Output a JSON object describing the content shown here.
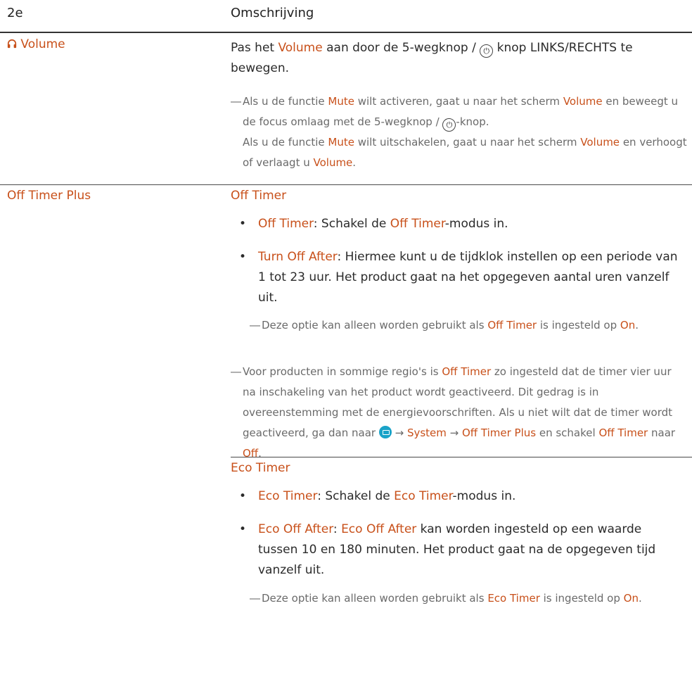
{
  "header": {
    "col1": "2e",
    "col2": "Omschrijving"
  },
  "volume": {
    "label": "Volume",
    "desc": [
      "Pas het ",
      "Volume",
      " aan door de 5-wegknop / ",
      " knop LINKS/RECHTS te bewegen."
    ],
    "note": [
      "Als u de functie ",
      "Mute",
      " wilt activeren, gaat u naar het scherm ",
      "Volume",
      " en beweegt u de focus omlaag met de 5-wegknop / ",
      "-knop.",
      "Als u de functie ",
      "Mute",
      " wilt uitschakelen, gaat u naar het scherm ",
      "Volume",
      " en verhoogt of verlaagt u ",
      "Volume",
      "."
    ]
  },
  "off_timer_plus": {
    "label": "Off Timer Plus",
    "off_timer": {
      "heading": "Off Timer",
      "bullet1": [
        "Off Timer",
        ": Schakel de ",
        "Off Timer",
        "-modus in."
      ],
      "bullet2": [
        "Turn Off After",
        ": Hiermee kunt u de tijdklok instellen op een periode van 1 tot 23 uur. Het product gaat na het opgegeven aantal uren vanzelf uit."
      ],
      "subnote": [
        "Deze optie kan alleen worden gebruikt als ",
        "Off Timer",
        " is ingesteld op ",
        "On",
        "."
      ],
      "note": [
        "Voor producten in sommige regio's is ",
        "Off Timer",
        " zo ingesteld dat de timer vier uur na inschakeling van het product wordt geactiveerd. Dit gedrag is in overeenstemming met de energievoorschriften. Als u niet wilt dat de timer wordt geactiveerd, ga dan naar ",
        " → ",
        "System",
        " → ",
        "Off Timer Plus",
        " en schakel ",
        "Off Timer",
        " naar ",
        "Off",
        "."
      ]
    },
    "eco_timer": {
      "heading": "Eco Timer",
      "bullet1": [
        "Eco Timer",
        ": Schakel de ",
        "Eco Timer",
        "-modus in."
      ],
      "bullet2": [
        "Eco Off After",
        ": ",
        "Eco Off After",
        " kan worden ingesteld op een waarde tussen 10 en 180 minuten. Het product gaat na de opgegeven tijd vanzelf uit."
      ],
      "subnote": [
        "Deze optie kan alleen worden gebruikt als ",
        "Eco Timer",
        " is ingesteld op ",
        "On",
        "."
      ]
    }
  },
  "glyphs": {
    "dash": "―",
    "bullet": "•",
    "power": "⏻",
    "arrow": "→"
  },
  "colors": {
    "highlight": "#c8501a",
    "note_text": "#6a6a6a",
    "menu_icon": "#1aa3c8"
  },
  "icons": {
    "volume": "headphones-icon",
    "menu": "menu-icon",
    "power": "power-icon"
  }
}
